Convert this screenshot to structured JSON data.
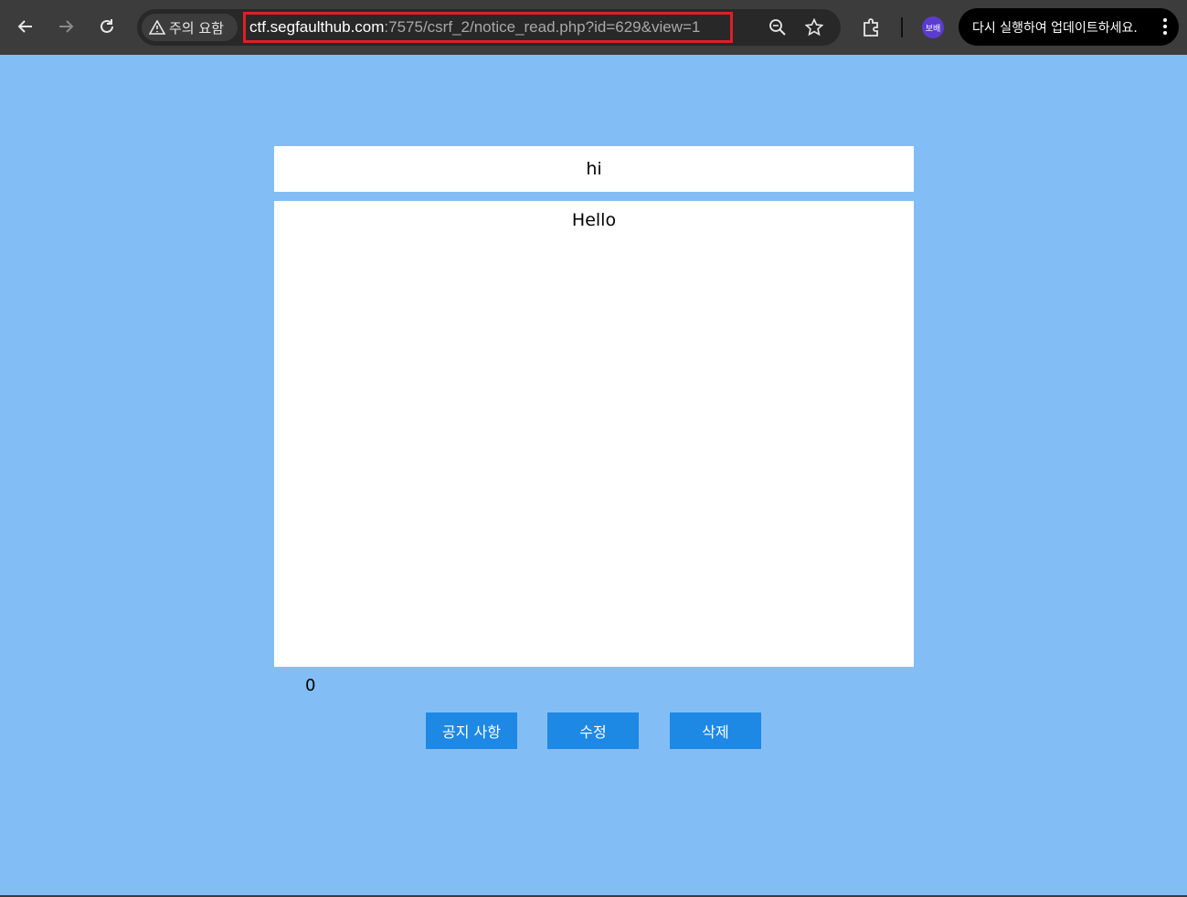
{
  "browser": {
    "security_label": "주의 요함",
    "url_host": "ctf.segfaulthub.com",
    "url_path": ":7575/csrf_2/notice_read.php?id=629&view=1",
    "profile_label": "보배",
    "update_label": "다시 실행하여 업데이트하세요."
  },
  "notice": {
    "title": "hi",
    "content": "Hello",
    "views": "0"
  },
  "buttons": {
    "list_label": "공지 사항",
    "edit_label": "수정",
    "delete_label": "삭제"
  },
  "colors": {
    "background": "#82bef5",
    "button": "#1e88e5",
    "url_highlight": "#e01e24"
  }
}
